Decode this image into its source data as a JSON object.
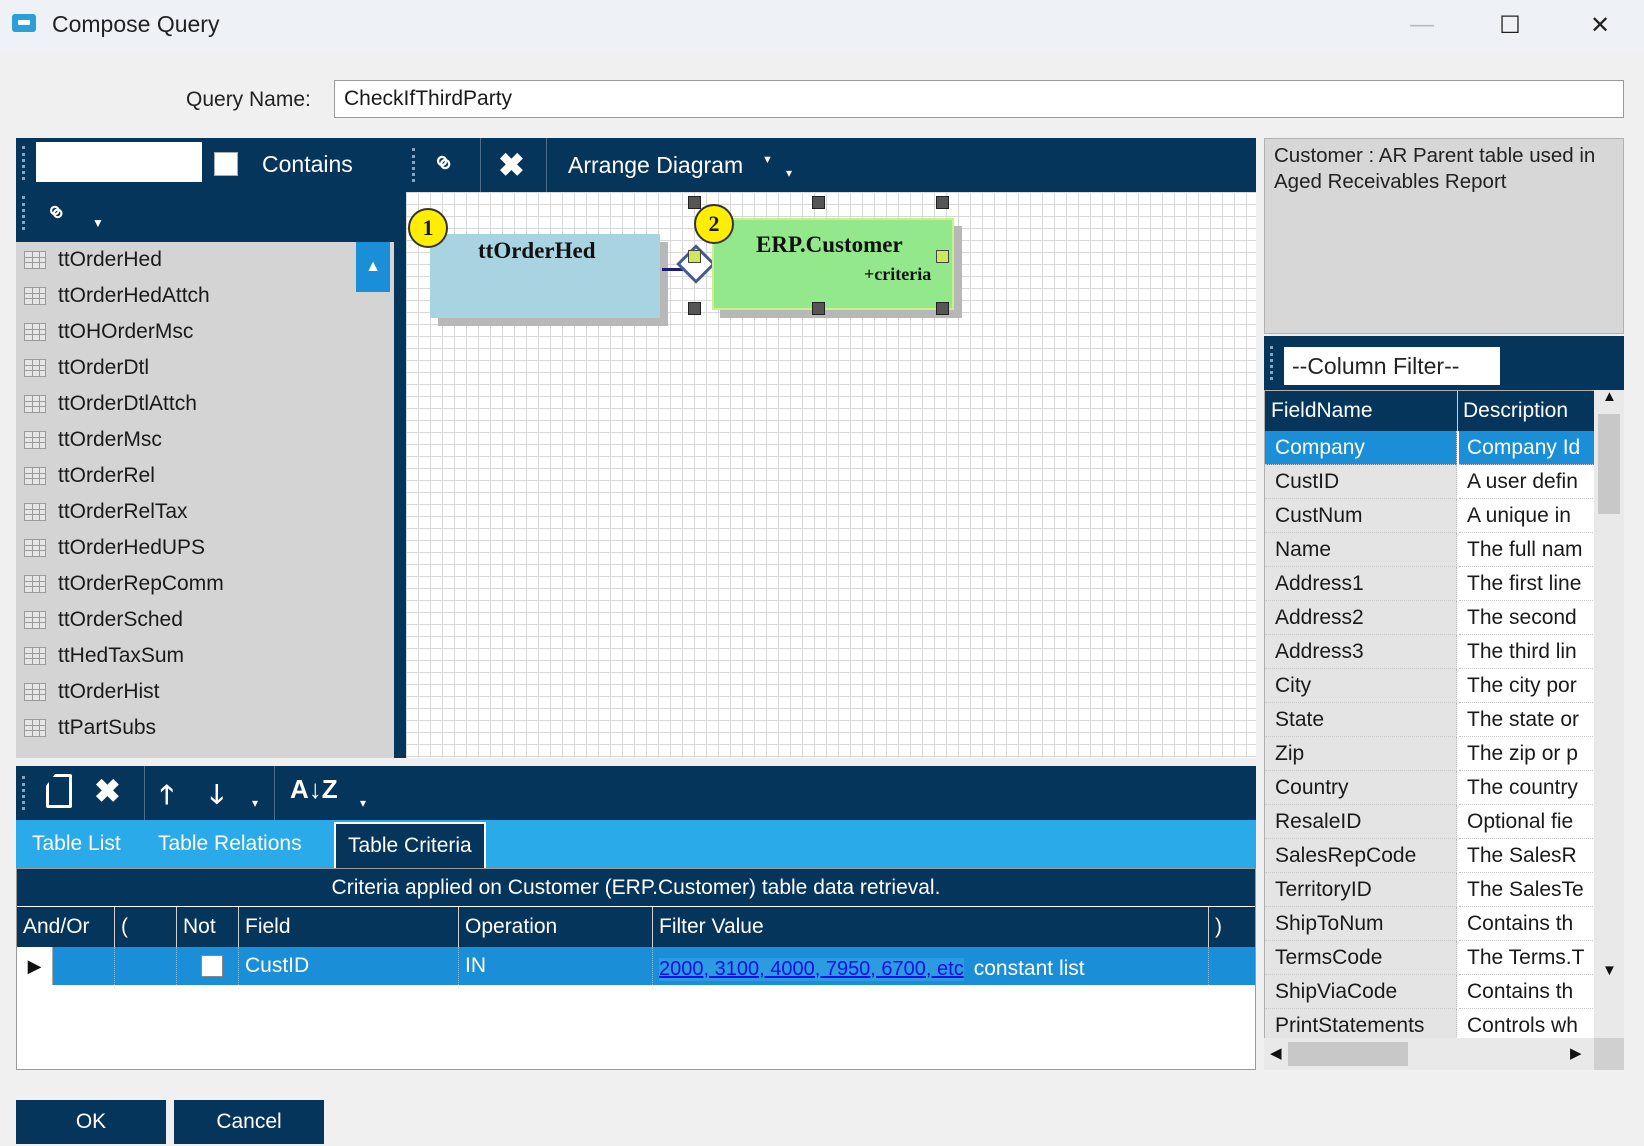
{
  "window": {
    "title": "Compose Query",
    "minimize": "—",
    "maximize": "☐",
    "close": "✕"
  },
  "query": {
    "label": "Query Name:",
    "value": "CheckIfThirdParty"
  },
  "table_panel": {
    "search_value": "",
    "contains_label": "Contains",
    "contains_checked": false,
    "tables": [
      "ttOrderHed",
      "ttOrderHedAttch",
      "ttOHOrderMsc",
      "ttOrderDtl",
      "ttOrderDtlAttch",
      "ttOrderMsc",
      "ttOrderRel",
      "ttOrderRelTax",
      "ttOrderHedUPS",
      "ttOrderRepComm",
      "ttOrderSched",
      "ttHedTaxSum",
      "ttOrderHist",
      "ttPartSubs"
    ]
  },
  "diagram": {
    "arrange_label": "Arrange Diagram",
    "nodes": [
      {
        "number": "1",
        "title": "ttOrderHed",
        "color": "#a8d4e2"
      },
      {
        "number": "2",
        "title": "ERP.Customer",
        "subtitle": "+criteria",
        "color": "#92e88a"
      }
    ]
  },
  "info": {
    "text": "Customer : AR Parent table used in Aged Receivables Report"
  },
  "fields": {
    "filter_value": "--Column Filter--",
    "headers": [
      "FieldName",
      "Description"
    ],
    "rows": [
      {
        "name": "Company",
        "desc": "Company Id",
        "selected": true
      },
      {
        "name": "CustID",
        "desc": "A user defin"
      },
      {
        "name": "CustNum",
        "desc": "A unique in"
      },
      {
        "name": "Name",
        "desc": "The full nam"
      },
      {
        "name": "Address1",
        "desc": "The first line"
      },
      {
        "name": "Address2",
        "desc": "The second"
      },
      {
        "name": "Address3",
        "desc": "The third lin"
      },
      {
        "name": "City",
        "desc": "The city por"
      },
      {
        "name": "State",
        "desc": "The state or"
      },
      {
        "name": "Zip",
        "desc": "The zip or p"
      },
      {
        "name": "Country",
        "desc": "The country"
      },
      {
        "name": "ResaleID",
        "desc": "Optional fie"
      },
      {
        "name": "SalesRepCode",
        "desc": "The SalesR"
      },
      {
        "name": "TerritoryID",
        "desc": "The SalesTe"
      },
      {
        "name": "ShipToNum",
        "desc": "Contains th"
      },
      {
        "name": "TermsCode",
        "desc": "The Terms.T"
      },
      {
        "name": "ShipViaCode",
        "desc": "Contains th"
      },
      {
        "name": "PrintStatements",
        "desc": "Controls wh"
      }
    ]
  },
  "tabs": [
    {
      "label": "Table List",
      "active": false
    },
    {
      "label": "Table Relations",
      "active": false
    },
    {
      "label": "Table Criteria",
      "active": true
    }
  ],
  "criteria": {
    "caption": "Criteria applied on Customer (ERP.Customer)  table data retrieval.",
    "headers": [
      "And/Or",
      "(",
      "Not",
      "Field",
      "Operation",
      "Filter Value",
      ")"
    ],
    "row": {
      "and_or": "",
      "open_paren": "",
      "not": false,
      "field": "CustID",
      "operation": "IN",
      "filter_link": "2000, 3100, 4000, 7950, 6700, etc",
      "filter_suffix": "constant list",
      "close_paren": ""
    }
  },
  "buttons": {
    "ok": "OK",
    "cancel": "Cancel"
  },
  "colors": {
    "toolbar_navy": "#06355b",
    "accent_blue": "#1a8ed6",
    "tab_bar": "#2aaae8"
  }
}
